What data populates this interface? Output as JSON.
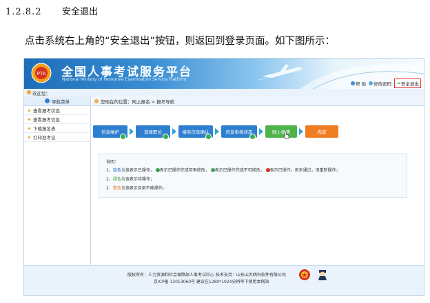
{
  "document": {
    "section_number": "1.2.8.2",
    "section_title": "安全退出",
    "paragraph": "点击系统右上角的“安全退出”按钮，则返回到登录页面。如下图所示："
  },
  "site": {
    "title": "全国人事考试服务平台",
    "subtitle": "National Ministry of Personnel Examination Service Platform",
    "help": "帮 助",
    "change_password": "修改密码",
    "logout": "安全退出"
  },
  "welcome": "欢迎您：",
  "sidebar": {
    "title": "导航菜单",
    "items": [
      {
        "label": "查看报考状态"
      },
      {
        "label": "查看报考信息"
      },
      {
        "label": "下载报名表"
      },
      {
        "label": "打印准考证"
      }
    ]
  },
  "breadcrumb": "您现在的位置：网上报名 > 报考导航",
  "steps": [
    {
      "label": "信息维护"
    },
    {
      "label": "选择职位"
    },
    {
      "label": "报名信息确认"
    },
    {
      "label": "信息审核状态"
    },
    {
      "label": "网上缴费"
    },
    {
      "label": "完成"
    }
  ],
  "notes": {
    "title": "说明：",
    "line1_prefix": "1、",
    "line1_blue": "蓝色",
    "line1_a": "为该表示已操作，",
    "line1_b": "表示已操作完成可再修改，",
    "line1_c": "表示已操作完成不可修改，",
    "line1_d": "表示已操作，但未通过，须重新操作；",
    "line2_prefix": "2、",
    "line2_green": "绿色",
    "line2_rest": "为该表示待操作；",
    "line3_prefix": "2、",
    "line3_orange": "橙色",
    "line3_rest": "为该表示目前不能操作。"
  },
  "footer": {
    "line1": "版权所有：人力资源和社会保障部人事考试中心  技术支持：山东山大鸥玛软件有限公司",
    "line2": "京ICP备 13013060号  建议在1280*1024分辨率下使用本网站"
  },
  "colors": {
    "blue_step": "#2f7fd0",
    "green_step": "#4fb34a",
    "orange_step": "#ef7d22",
    "logout_border": "#e03030"
  }
}
